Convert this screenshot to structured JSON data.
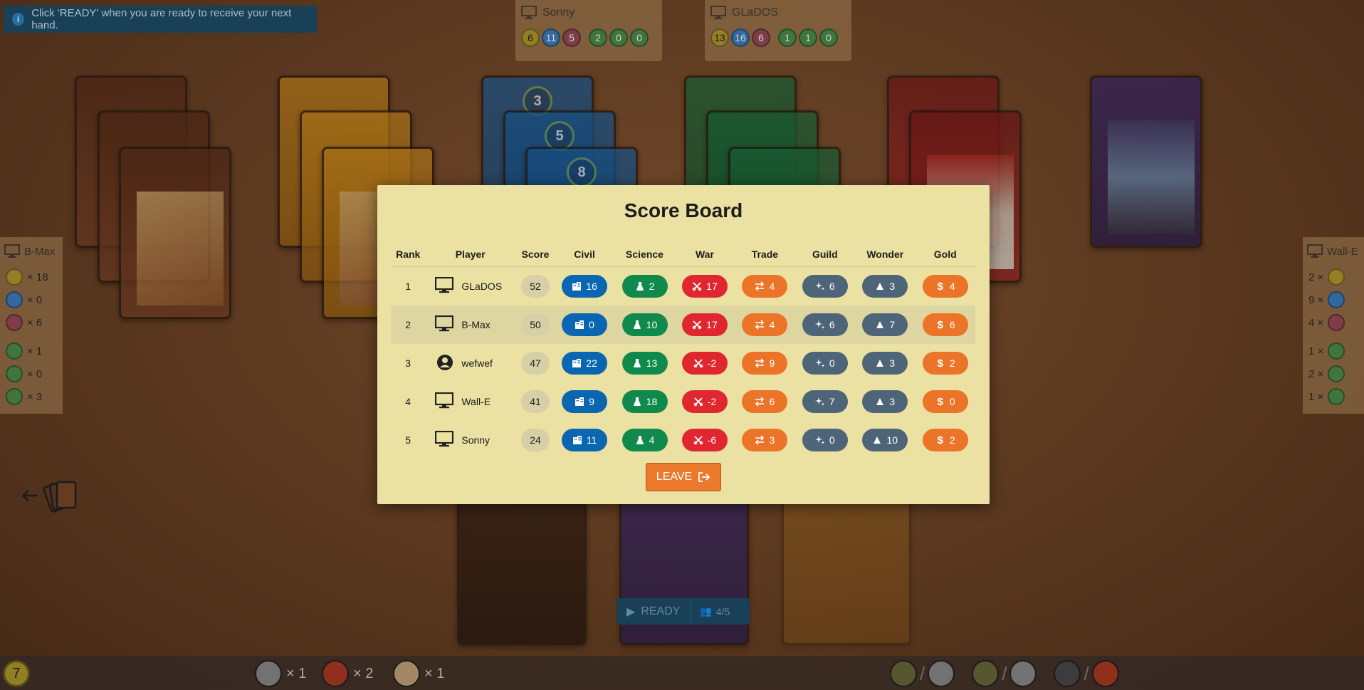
{
  "notice": {
    "text": "Click 'READY' when you are ready to receive your next hand."
  },
  "opponents_top": [
    {
      "name": "Sonny",
      "tokens": [
        "6",
        "11",
        "5",
        "2",
        "0",
        "0"
      ]
    },
    {
      "name": "GLaDOS",
      "tokens": [
        "13",
        "16",
        "6",
        "1",
        "1",
        "0"
      ]
    }
  ],
  "side_left": {
    "name": "B-Max",
    "rows": [
      "× 18",
      "× 0",
      "× 6",
      "× 1",
      "× 0",
      "× 3"
    ]
  },
  "side_right": {
    "name": "Wall-E",
    "rows": [
      "2 ×",
      "9 ×",
      "4 ×",
      "1 ×",
      "2 ×",
      "1 ×"
    ]
  },
  "scoreboard": {
    "title": "Score Board",
    "headers": [
      "Rank",
      "Player",
      "Score",
      "Civil",
      "Science",
      "War",
      "Trade",
      "Guild",
      "Wonder",
      "Gold"
    ],
    "rows": [
      {
        "rank": "1",
        "player": "GLaDOS",
        "type": "computer",
        "score": "52",
        "civil": "16",
        "science": "2",
        "war": "17",
        "trade": "4",
        "guild": "6",
        "wonder": "3",
        "gold": "4"
      },
      {
        "rank": "2",
        "player": "B-Max",
        "type": "computer",
        "score": "50",
        "civil": "0",
        "science": "10",
        "war": "17",
        "trade": "4",
        "guild": "6",
        "wonder": "7",
        "gold": "6"
      },
      {
        "rank": "3",
        "player": "wefwef",
        "type": "human",
        "score": "47",
        "civil": "22",
        "science": "13",
        "war": "-2",
        "trade": "9",
        "guild": "0",
        "wonder": "3",
        "gold": "2"
      },
      {
        "rank": "4",
        "player": "Wall-E",
        "type": "computer",
        "score": "41",
        "civil": "9",
        "science": "18",
        "war": "-2",
        "trade": "6",
        "guild": "7",
        "wonder": "3",
        "gold": "0"
      },
      {
        "rank": "5",
        "player": "Sonny",
        "type": "computer",
        "score": "24",
        "civil": "11",
        "science": "4",
        "war": "-6",
        "trade": "3",
        "guild": "0",
        "wonder": "10",
        "gold": "2"
      }
    ],
    "leave_label": "LEAVE"
  },
  "ready": {
    "label": "READY",
    "count": "4/5"
  },
  "bottom": {
    "coins": "7",
    "res1": "× 1",
    "res2": "× 2",
    "res3": "× 1"
  },
  "colors": {
    "civil": "#0a66b0",
    "science": "#0f8a4c",
    "war": "#e0262f",
    "trade": "#ec7428",
    "guild": "#4e6478",
    "wonder": "#4e6478",
    "gold": "#ec7428",
    "modal_bg": "#ebe1a2"
  }
}
